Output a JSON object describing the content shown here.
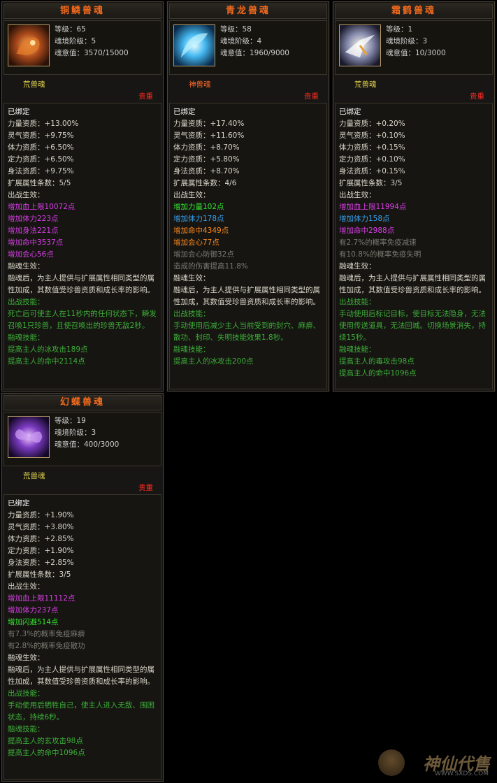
{
  "cards": [
    {
      "title": "铜鳞兽魂",
      "level": "等级：65",
      "realm": "魂境阶级：5",
      "intent": "魂意值：3570/15000",
      "type": "荒兽魂",
      "type_color": "#e0d14a",
      "rarity": "贵重",
      "lines": [
        {
          "text": "已绑定",
          "c": "c-white"
        },
        {
          "text": "力量资质：+13.00%",
          "c": "c-label"
        },
        {
          "text": "灵气资质：+9.75%",
          "c": "c-label"
        },
        {
          "text": "体力资质：+6.50%",
          "c": "c-label"
        },
        {
          "text": "定力资质：+6.50%",
          "c": "c-label"
        },
        {
          "text": "身法资质：+9.75%",
          "c": "c-label"
        },
        {
          "text": "扩展属性条数：5/5",
          "c": "c-label"
        },
        {
          "text": "出战生效：",
          "c": "c-label"
        },
        {
          "text": "增加血上限10072点",
          "c": "c-magenta"
        },
        {
          "text": "增加体力223点",
          "c": "c-magenta"
        },
        {
          "text": "增加身法221点",
          "c": "c-magenta"
        },
        {
          "text": "增加命中3537点",
          "c": "c-magenta"
        },
        {
          "text": "增加会心56点",
          "c": "c-magenta"
        },
        {
          "text": "融魂生效：",
          "c": "c-label"
        },
        {
          "text": "融魂后，为主人提供与扩展属性相同类型的属性加成，其数值受珍兽资质和成长率的影响。",
          "c": "c-label"
        },
        {
          "text": "出战技能：",
          "c": "c-skill"
        },
        {
          "text": "死亡后可使主人在11秒内的任何状态下，瞬发召唤1只珍兽，且使召唤出的珍兽无敌2秒。",
          "c": "c-skill"
        },
        {
          "text": "融魂技能：",
          "c": "c-skill"
        },
        {
          "text": "提高主人的冰攻击189点",
          "c": "c-skill"
        },
        {
          "text": "提高主人的命中2114点",
          "c": "c-skill"
        }
      ]
    },
    {
      "title": "青龙兽魂",
      "level": "等级：58",
      "realm": "魂境阶级：4",
      "intent": "魂意值：1960/9000",
      "type": "神兽魂",
      "type_color": "#ff6a2a",
      "rarity": "贵重",
      "lines": [
        {
          "text": "已绑定",
          "c": "c-white"
        },
        {
          "text": "力量资质：+17.40%",
          "c": "c-label"
        },
        {
          "text": "灵气资质：+11.60%",
          "c": "c-label"
        },
        {
          "text": "体力资质：+8.70%",
          "c": "c-label"
        },
        {
          "text": "定力资质：+5.80%",
          "c": "c-label"
        },
        {
          "text": "身法资质：+8.70%",
          "c": "c-label"
        },
        {
          "text": "扩展属性条数：4/6",
          "c": "c-label"
        },
        {
          "text": "出战生效：",
          "c": "c-label"
        },
        {
          "text": "增加力量102点",
          "c": "c-green"
        },
        {
          "text": "增加体力178点",
          "c": "c-blue"
        },
        {
          "text": "增加命中4349点",
          "c": "c-orange"
        },
        {
          "text": "增加会心77点",
          "c": "c-orange"
        },
        {
          "text": "增加会心防御32点",
          "c": "c-gray"
        },
        {
          "text": "造成的伤害提高11.8%",
          "c": "c-gray"
        },
        {
          "text": "融魂生效：",
          "c": "c-label"
        },
        {
          "text": "融魂后，为主人提供与扩展属性相同类型的属性加成，其数值受珍兽资质和成长率的影响。",
          "c": "c-label"
        },
        {
          "text": "出战技能：",
          "c": "c-skill"
        },
        {
          "text": "手动使用后减少主人当前受到的封穴、麻痹、散功、封印、失明技能效果1.8秒。",
          "c": "c-skill"
        },
        {
          "text": "融魂技能：",
          "c": "c-skill"
        },
        {
          "text": "提高主人的冰攻击200点",
          "c": "c-skill"
        }
      ]
    },
    {
      "title": "霜鹤兽魂",
      "level": "等级：1",
      "realm": "魂境阶级：3",
      "intent": "魂意值：10/3000",
      "type": "荒兽魂",
      "type_color": "#e0d14a",
      "rarity": "贵重",
      "lines": [
        {
          "text": "已绑定",
          "c": "c-white"
        },
        {
          "text": "力量资质：+0.20%",
          "c": "c-label"
        },
        {
          "text": "灵气资质：+0.10%",
          "c": "c-label"
        },
        {
          "text": "体力资质：+0.15%",
          "c": "c-label"
        },
        {
          "text": "定力资质：+0.10%",
          "c": "c-label"
        },
        {
          "text": "身法资质：+0.15%",
          "c": "c-label"
        },
        {
          "text": "扩展属性条数：3/5",
          "c": "c-label"
        },
        {
          "text": "出战生效：",
          "c": "c-label"
        },
        {
          "text": "增加血上限11994点",
          "c": "c-magenta"
        },
        {
          "text": "增加体力158点",
          "c": "c-blue"
        },
        {
          "text": "增加命中2988点",
          "c": "c-magenta"
        },
        {
          "text": "有2.7%的概率免疫减速",
          "c": "c-gray"
        },
        {
          "text": "有10.8%的概率免疫失明",
          "c": "c-gray"
        },
        {
          "text": "融魂生效：",
          "c": "c-label"
        },
        {
          "text": "融魂后，为主人提供与扩展属性相同类型的属性加成，其数值受珍兽资质和成长率的影响。",
          "c": "c-label"
        },
        {
          "text": "出战技能：",
          "c": "c-skill"
        },
        {
          "text": "手动使用后标记目标，使目标无法隐身，无法使用传送道具，无法回城。切换场景消失，持续15秒。",
          "c": "c-skill"
        },
        {
          "text": "融魂技能：",
          "c": "c-skill"
        },
        {
          "text": "提高主人的毒攻击98点",
          "c": "c-skill"
        },
        {
          "text": "提高主人的命中1096点",
          "c": "c-skill"
        }
      ]
    },
    {
      "title": "幻蝶兽魂",
      "level": "等级：19",
      "realm": "魂境阶级：3",
      "intent": "魂意值：400/3000",
      "type": "荒兽魂",
      "type_color": "#e0d14a",
      "rarity": "贵重",
      "lines": [
        {
          "text": "已绑定",
          "c": "c-white"
        },
        {
          "text": "力量资质：+1.90%",
          "c": "c-label"
        },
        {
          "text": "灵气资质：+3.80%",
          "c": "c-label"
        },
        {
          "text": "体力资质：+2.85%",
          "c": "c-label"
        },
        {
          "text": "定力资质：+1.90%",
          "c": "c-label"
        },
        {
          "text": "身法资质：+2.85%",
          "c": "c-label"
        },
        {
          "text": "扩展属性条数：3/5",
          "c": "c-label"
        },
        {
          "text": "出战生效：",
          "c": "c-label"
        },
        {
          "text": "增加血上限11112点",
          "c": "c-magenta"
        },
        {
          "text": "增加体力237点",
          "c": "c-magenta"
        },
        {
          "text": "增加闪避514点",
          "c": "c-green"
        },
        {
          "text": "有7.3%的概率免疫麻痹",
          "c": "c-gray"
        },
        {
          "text": "有2.8%的概率免疫散功",
          "c": "c-gray"
        },
        {
          "text": "融魂生效：",
          "c": "c-label"
        },
        {
          "text": "融魂后，为主人提供与扩展属性相同类型的属性加成，其数值受珍兽资质和成长率的影响。",
          "c": "c-label"
        },
        {
          "text": "出战技能：",
          "c": "c-skill"
        },
        {
          "text": "手动使用后牺牲自己，使主人进入无敌、围困状态，持续6秒。",
          "c": "c-skill"
        },
        {
          "text": "融魂技能：",
          "c": "c-skill"
        },
        {
          "text": "提高主人的玄攻击98点",
          "c": "c-skill"
        },
        {
          "text": "提高主人的命中1096点",
          "c": "c-skill"
        }
      ]
    }
  ],
  "watermark": {
    "text": "神仙代售",
    "url": "WWW.SXDS.COM"
  }
}
